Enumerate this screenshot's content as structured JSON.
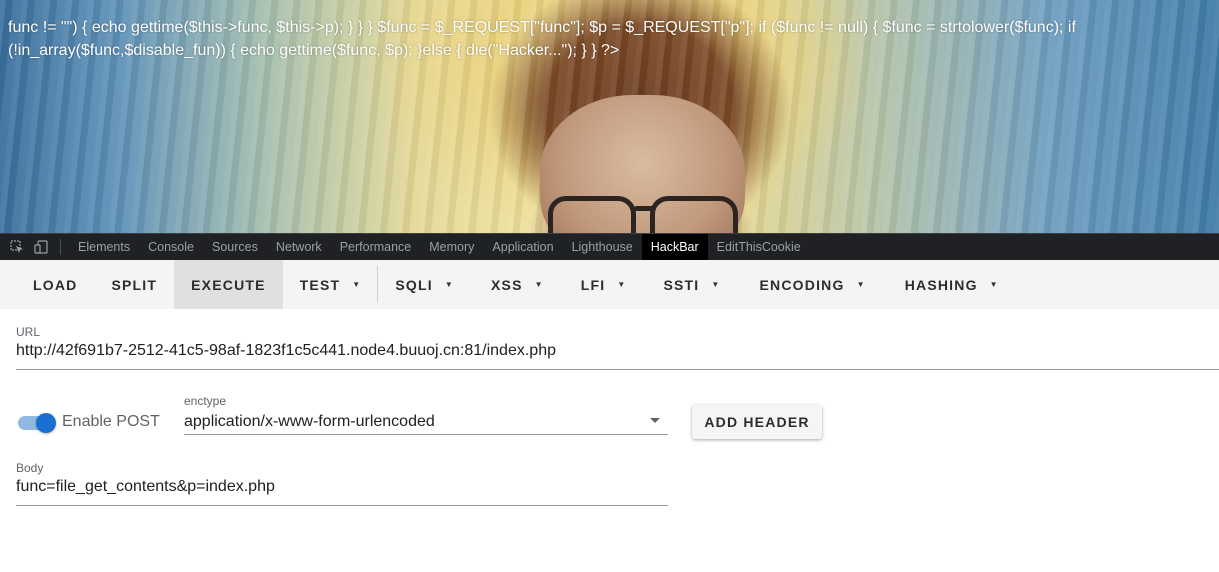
{
  "page": {
    "code_text": "func != \"\") { echo gettime($this->func, $this->p); } } } $func = $_REQUEST[\"func\"]; $p = $_REQUEST[\"p\"]; if ($func != null) { $func = strtolower($func); if (!in_array($func,$disable_fun)) { echo gettime($func, $p); }else { die(\"Hacker...\"); } } ?>"
  },
  "devtools": {
    "tabs": [
      "Elements",
      "Console",
      "Sources",
      "Network",
      "Performance",
      "Memory",
      "Application",
      "Lighthouse",
      "HackBar",
      "EditThisCookie"
    ],
    "active_tab": "HackBar"
  },
  "hackbar": {
    "buttons": {
      "load": "LOAD",
      "split": "SPLIT",
      "execute": "EXECUTE",
      "test": "TEST",
      "sqli": "SQLI",
      "xss": "XSS",
      "lfi": "LFI",
      "ssti": "SSTI",
      "encoding": "ENCODING",
      "hashing": "HASHING"
    },
    "url_label": "URL",
    "url_value": "http://42f691b7-2512-41c5-98af-1823f1c5c441.node4.buuoj.cn:81/index.php",
    "enable_post_label": "Enable POST",
    "enable_post": true,
    "enctype_label": "enctype",
    "enctype_value": "application/x-www-form-urlencoded",
    "add_header_label": "ADD HEADER",
    "body_label": "Body",
    "body_value": "func=file_get_contents&p=index.php"
  },
  "colors": {
    "accent": "#1a6fd1",
    "devtools_bg": "#202124",
    "toolbar_bg": "#f4f4f4"
  }
}
